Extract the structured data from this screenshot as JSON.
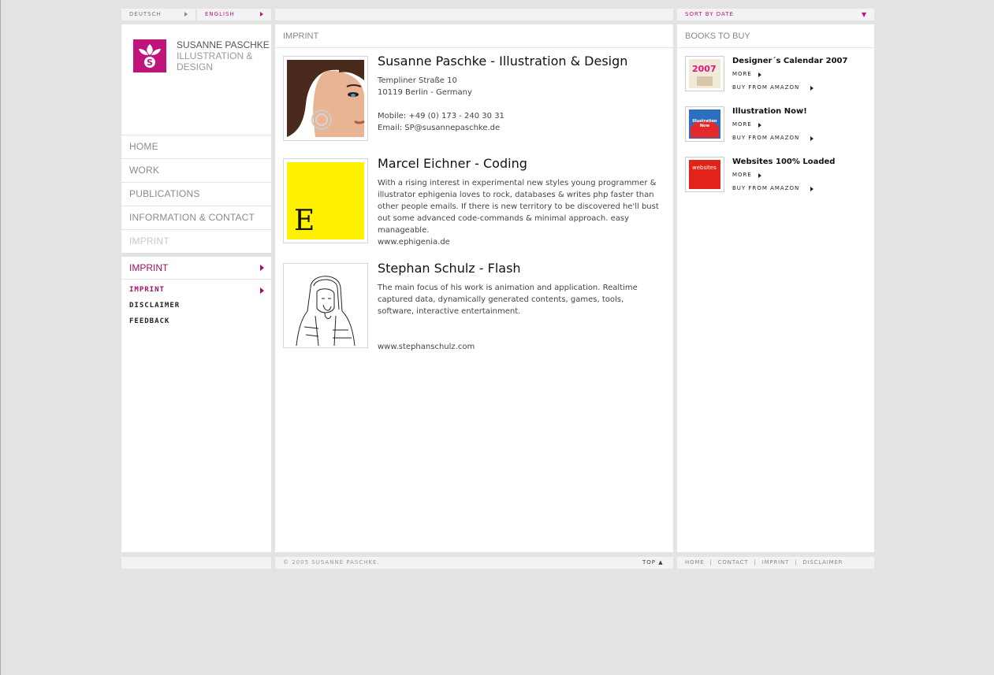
{
  "lang": {
    "deutsch": "Deutsch",
    "english": "English"
  },
  "sort": {
    "label": "Sort by date"
  },
  "brand": {
    "name_line1": "Susanne Paschke",
    "name_line2": "Illustration &",
    "name_line3": "Design",
    "color": "#c0147a"
  },
  "nav": {
    "items": [
      {
        "label": "Home"
      },
      {
        "label": "Work"
      },
      {
        "label": "Publications"
      },
      {
        "label": "Information & Contact"
      },
      {
        "label": "Imprint"
      }
    ]
  },
  "subnav": {
    "title": "Imprint",
    "items": [
      {
        "label": "Imprint"
      },
      {
        "label": "Disclaimer"
      },
      {
        "label": "Feedback"
      }
    ]
  },
  "main": {
    "header": "Imprint",
    "entries": [
      {
        "title": "Susanne Paschke - Illustration & Design",
        "lines": [
          "Templiner Straße 10",
          "10119 Berlin - Germany",
          "",
          "Mobile: +49 (0) 173 - 240 30 31",
          "Email: SP@susannepaschke.de"
        ]
      },
      {
        "title": "Marcel Eichner - Coding",
        "text": "With a rising interest in experimental new styles young programmer & illustrator ephigenia loves to rock, databases & writes php faster than other people emails. If there is new territory to be discovered he'll bust out some advanced code-commands & minimal approach. easy manageable.",
        "link": "www.ephigenia.de",
        "logo_letter": "E"
      },
      {
        "title": "Stephan Schulz - Flash",
        "text": "The main focus of his work is animation and application. Realtime captured data, dynamically generated contents, games, tools, software, interactive entertainment.",
        "link": "www.stephanschulz.com"
      }
    ]
  },
  "books": {
    "header": "Books to buy",
    "items": [
      {
        "title": "Designer´s Calendar 2007",
        "more": "More",
        "buy": "Buy from Amazon",
        "cover_text": "2007"
      },
      {
        "title": "Illustration Now!",
        "more": "More",
        "buy": "Buy from Amazon",
        "cover_text": "Illustration Now"
      },
      {
        "title": "Websites 100% Loaded",
        "more": "More",
        "buy": "Buy from Amazon",
        "cover_text": "websites"
      }
    ]
  },
  "footer": {
    "copyright": "© 2005 Susanne Paschke.",
    "top": "Top",
    "links": [
      "Home",
      "Contact",
      "Imprint",
      "Disclaimer"
    ],
    "sep": "|"
  }
}
